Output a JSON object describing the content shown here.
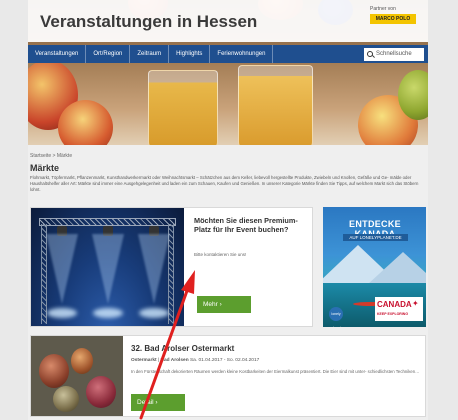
{
  "header": {
    "site_title": "Veranstaltungen in Hessen",
    "partner_text": "Partner von",
    "partner_logo": "MARCO POLO"
  },
  "nav": {
    "items": [
      {
        "label": "Veranstaltungen"
      },
      {
        "label": "Ort/Region"
      },
      {
        "label": "Zeitraum"
      },
      {
        "label": "Highlights"
      },
      {
        "label": "Ferienwohnungen"
      }
    ],
    "search_label": "Schnellsuche"
  },
  "breadcrumb": "Startseite > Märkte",
  "page_title": "Märkte",
  "intro_text": "Flohmarkt, Töpfermarkt, Pflanzenmarkt, Kunsthandwerkermarkt oder Weihnachtsmarkt – Schätzchen aus dem Keller, liebevoll hergestellte Produkte, Zwiebeln und Knollen, Gefäße und Ge- mälde oder Haushaltshelfer aller Art: Märkte sind immer eine Ausgehgelegenheit und laden ein zum Schauen, Kaufen und Genießen. In unserer Kategorie Märkte finden Sie Tipps, auf welchem Markt sich das Stöbern lohnt.",
  "feature": {
    "title": "Möchten Sie diesen Premium-Platz für Ihr Event buchen?",
    "text": "Bitte kontaktieren Sie uns!",
    "button_label": "Mehr ›"
  },
  "ad": {
    "title": "ENTDECKE KANADA",
    "subtitle": "AUF LONELYPLANET.DE",
    "lp_logo": "lonely planet",
    "canada_word": "CANADA",
    "canada_tagline": "KEEP EXPLORING"
  },
  "event": {
    "title": "32. Bad Arolser Ostermarkt",
    "meta_label": "Ostermarkt",
    "meta_place": "Bad Arolsen",
    "meta_date": "Sa. 01.04.2017 - So. 02.04.2017",
    "description": "In den Fürstenschaft dekorierten Räumen werden kleine Kostbarkeiten der Eiermalkunst präsentiert. Die Eier sind mit unter- schiedlichsten Techniken…",
    "button_label": "Detail ›"
  },
  "colors": {
    "nav_blue": "#1f4f8f",
    "button_green": "#5c9e2e",
    "annotation_arrow": "#e0201f"
  }
}
